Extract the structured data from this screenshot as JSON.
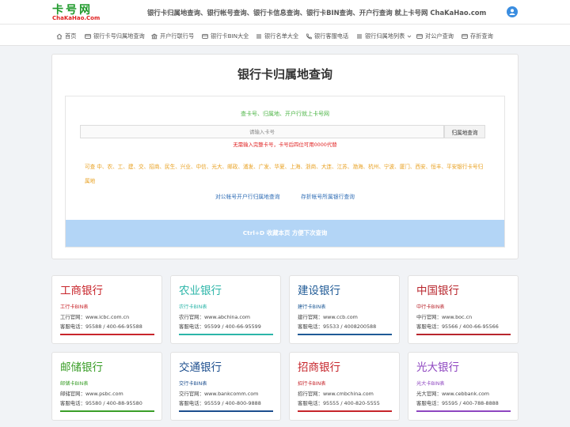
{
  "header": {
    "logo_cn": "卡号网",
    "logo_en": "ChaKaHao.Com",
    "headline": "银行卡归属地查询、银行帐号查询、银行卡信息查询、银行卡BIN查询、开户行查询 就上卡号网 ChaKaHao.com"
  },
  "nav": [
    {
      "label": "首页",
      "icon": "home-icon"
    },
    {
      "label": "银行卡号归属地查询",
      "icon": "card-icon"
    },
    {
      "label": "开户行联行号",
      "icon": "bank-icon"
    },
    {
      "label": "银行卡BIN大全",
      "icon": "card-icon"
    },
    {
      "label": "银行名单大全",
      "icon": "list-icon"
    },
    {
      "label": "银行客服电话",
      "icon": "phone-icon"
    },
    {
      "label": "银行归属地列表",
      "icon": "list-icon"
    },
    {
      "label": "对公户查询",
      "icon": "card-icon"
    },
    {
      "label": "存折查询",
      "icon": "card-icon"
    }
  ],
  "search": {
    "title": "银行卡归属地查询",
    "slogan": "查卡号、归属地、开户行就上卡号网",
    "placeholder": "请输入卡号",
    "button": "归属地查询",
    "hint": "无需输入完整卡号，卡号后四位可用0000代替",
    "banks_line1": "可查 中、农、工、建、交、招商、民生、兴业、中信、光大、邮政、浦发、广发、华夏、上海、浙商、大连、江苏、渤海、杭州、宁波、厦门、西安、恒丰、平安银行卡号归属地",
    "link1": "对公帐号开户行归属地查询",
    "link2": "存折帐号所属银行查询",
    "cta": "Ctrl+D 收藏本页 方便下次查询"
  },
  "cards": [
    {
      "name": "工商银行",
      "bin": "工行卡BIN表",
      "site": "工行官网：www.icbc.com.cn",
      "tel": "客服电话：95588 / 400-66-95588",
      "color": "#c8252b"
    },
    {
      "name": "农业银行",
      "bin": "农行卡BIN表",
      "site": "农行官网：www.abchina.com",
      "tel": "客服电话：95599 / 400-66-95599",
      "color": "#2bb5a8"
    },
    {
      "name": "建设银行",
      "bin": "建行卡BIN表",
      "site": "建行官网：www.ccb.com",
      "tel": "客服电话：95533 / 4008200588",
      "color": "#1f5a96"
    },
    {
      "name": "中国银行",
      "bin": "中行卡BIN表",
      "site": "中行官网：www.boc.cn",
      "tel": "客服电话：95566 / 400-66-95566",
      "color": "#b8262d"
    },
    {
      "name": "邮储银行",
      "bin": "邮储卡BIN表",
      "site": "邮储官网：www.psbc.com",
      "tel": "客服电话：95580 / 400-88-95580",
      "color": "#3a9e28"
    },
    {
      "name": "交通银行",
      "bin": "交行卡BIN表",
      "site": "交行官网：www.bankcomm.com",
      "tel": "客服电话：95559 / 400-800-9888",
      "color": "#1c4e8e"
    },
    {
      "name": "招商银行",
      "bin": "招行卡BIN表",
      "site": "招行官网：www.cmbchina.com",
      "tel": "客服电话：95555 / 400-820-5555",
      "color": "#c6252b"
    },
    {
      "name": "光大银行",
      "bin": "光大卡BIN表",
      "site": "光大官网：www.cebbank.com",
      "tel": "客服电话：95595 / 400-788-8888",
      "color": "#8e46c0"
    }
  ]
}
